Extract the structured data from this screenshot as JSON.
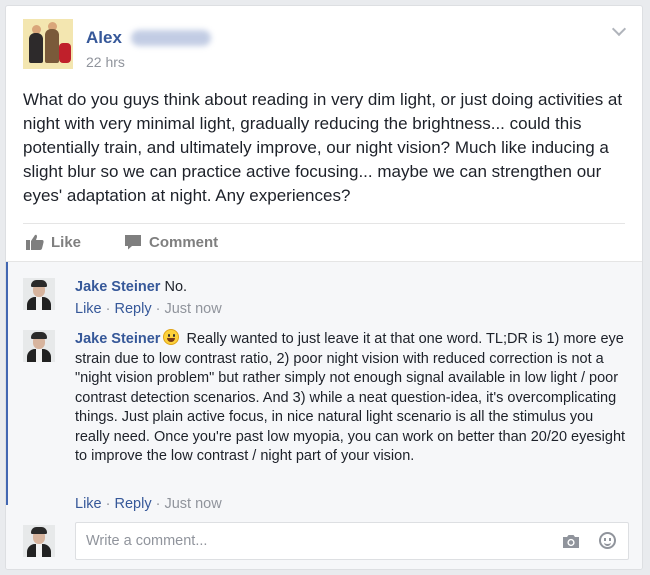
{
  "post": {
    "author_first_name": "Alex",
    "timestamp": "22 hrs",
    "text": "What do you guys think about reading in very dim light, or just doing activities at night with very minimal light, gradually reducing the brightness... could this potentially train, and ultimately improve, our night vision? Much like inducing a slight blur so we can practice active focusing... maybe we can strengthen our eyes' adaptation at night. Any experiences?",
    "menu_icon": "chevron-down-icon"
  },
  "actions": {
    "like_label": "Like",
    "comment_label": "Comment",
    "like_icon": "thumbs-up-icon",
    "comment_icon": "speech-bubble-icon"
  },
  "comments": [
    {
      "author": "Jake Steiner",
      "text": "No.",
      "like_label": "Like",
      "reply_label": "Reply",
      "time": "Just now"
    },
    {
      "author": "Jake Steiner",
      "emoji": "smiley-icon",
      "text": "Really wanted to just leave it at that one word. TL;DR is 1) more eye strain due to low contrast ratio, 2) poor night vision with reduced correction is not a \"night vision problem\" but rather simply not enough signal available in low light / poor contrast detection scenarios. And 3) while a neat question-idea, it's overcomplicating things. Just plain active focus, in nice natural light scenario is all the stimulus you really need. Once you're past low myopia, you can work on better than 20/20 eyesight to improve the low contrast / night part of your vision.",
      "like_label": "Like",
      "reply_label": "Reply",
      "time": "Just now"
    }
  ],
  "composer": {
    "placeholder": "Write a comment...",
    "camera_icon": "camera-icon",
    "emoji_icon": "emoji-icon"
  },
  "colors": {
    "link_blue": "#365899",
    "accent_bar": "#4267b2",
    "meta_gray": "#90949c",
    "text": "#1d2129"
  }
}
